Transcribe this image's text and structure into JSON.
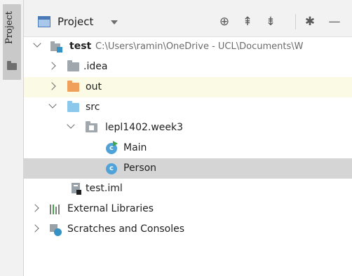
{
  "sidebar": {
    "tab_label": "Project"
  },
  "toolbar": {
    "view_selector_label": "Project",
    "icons": [
      "locate-icon",
      "expand-all-icon",
      "collapse-all-icon",
      "gear-icon",
      "hide-icon"
    ]
  },
  "tree": {
    "root": {
      "name": "test",
      "path": "C:\\Users\\ramin\\OneDrive - UCL\\Documents\\W"
    },
    "idea": "idea",
    "out": "out",
    "src": "src",
    "package": "lepl1402.week3",
    "main_class": "Main",
    "person_class": "Person",
    "iml": "test.iml",
    "external_libraries": "External Libraries",
    "scratches": "Scratches and Consoles"
  },
  "colors": {
    "selected_row": "#d5d5d5",
    "highlight_row": "#fbfae4",
    "out_folder": "#f0a05a",
    "src_folder": "#8cc8ec",
    "class_icon": "#4fa3d8"
  }
}
